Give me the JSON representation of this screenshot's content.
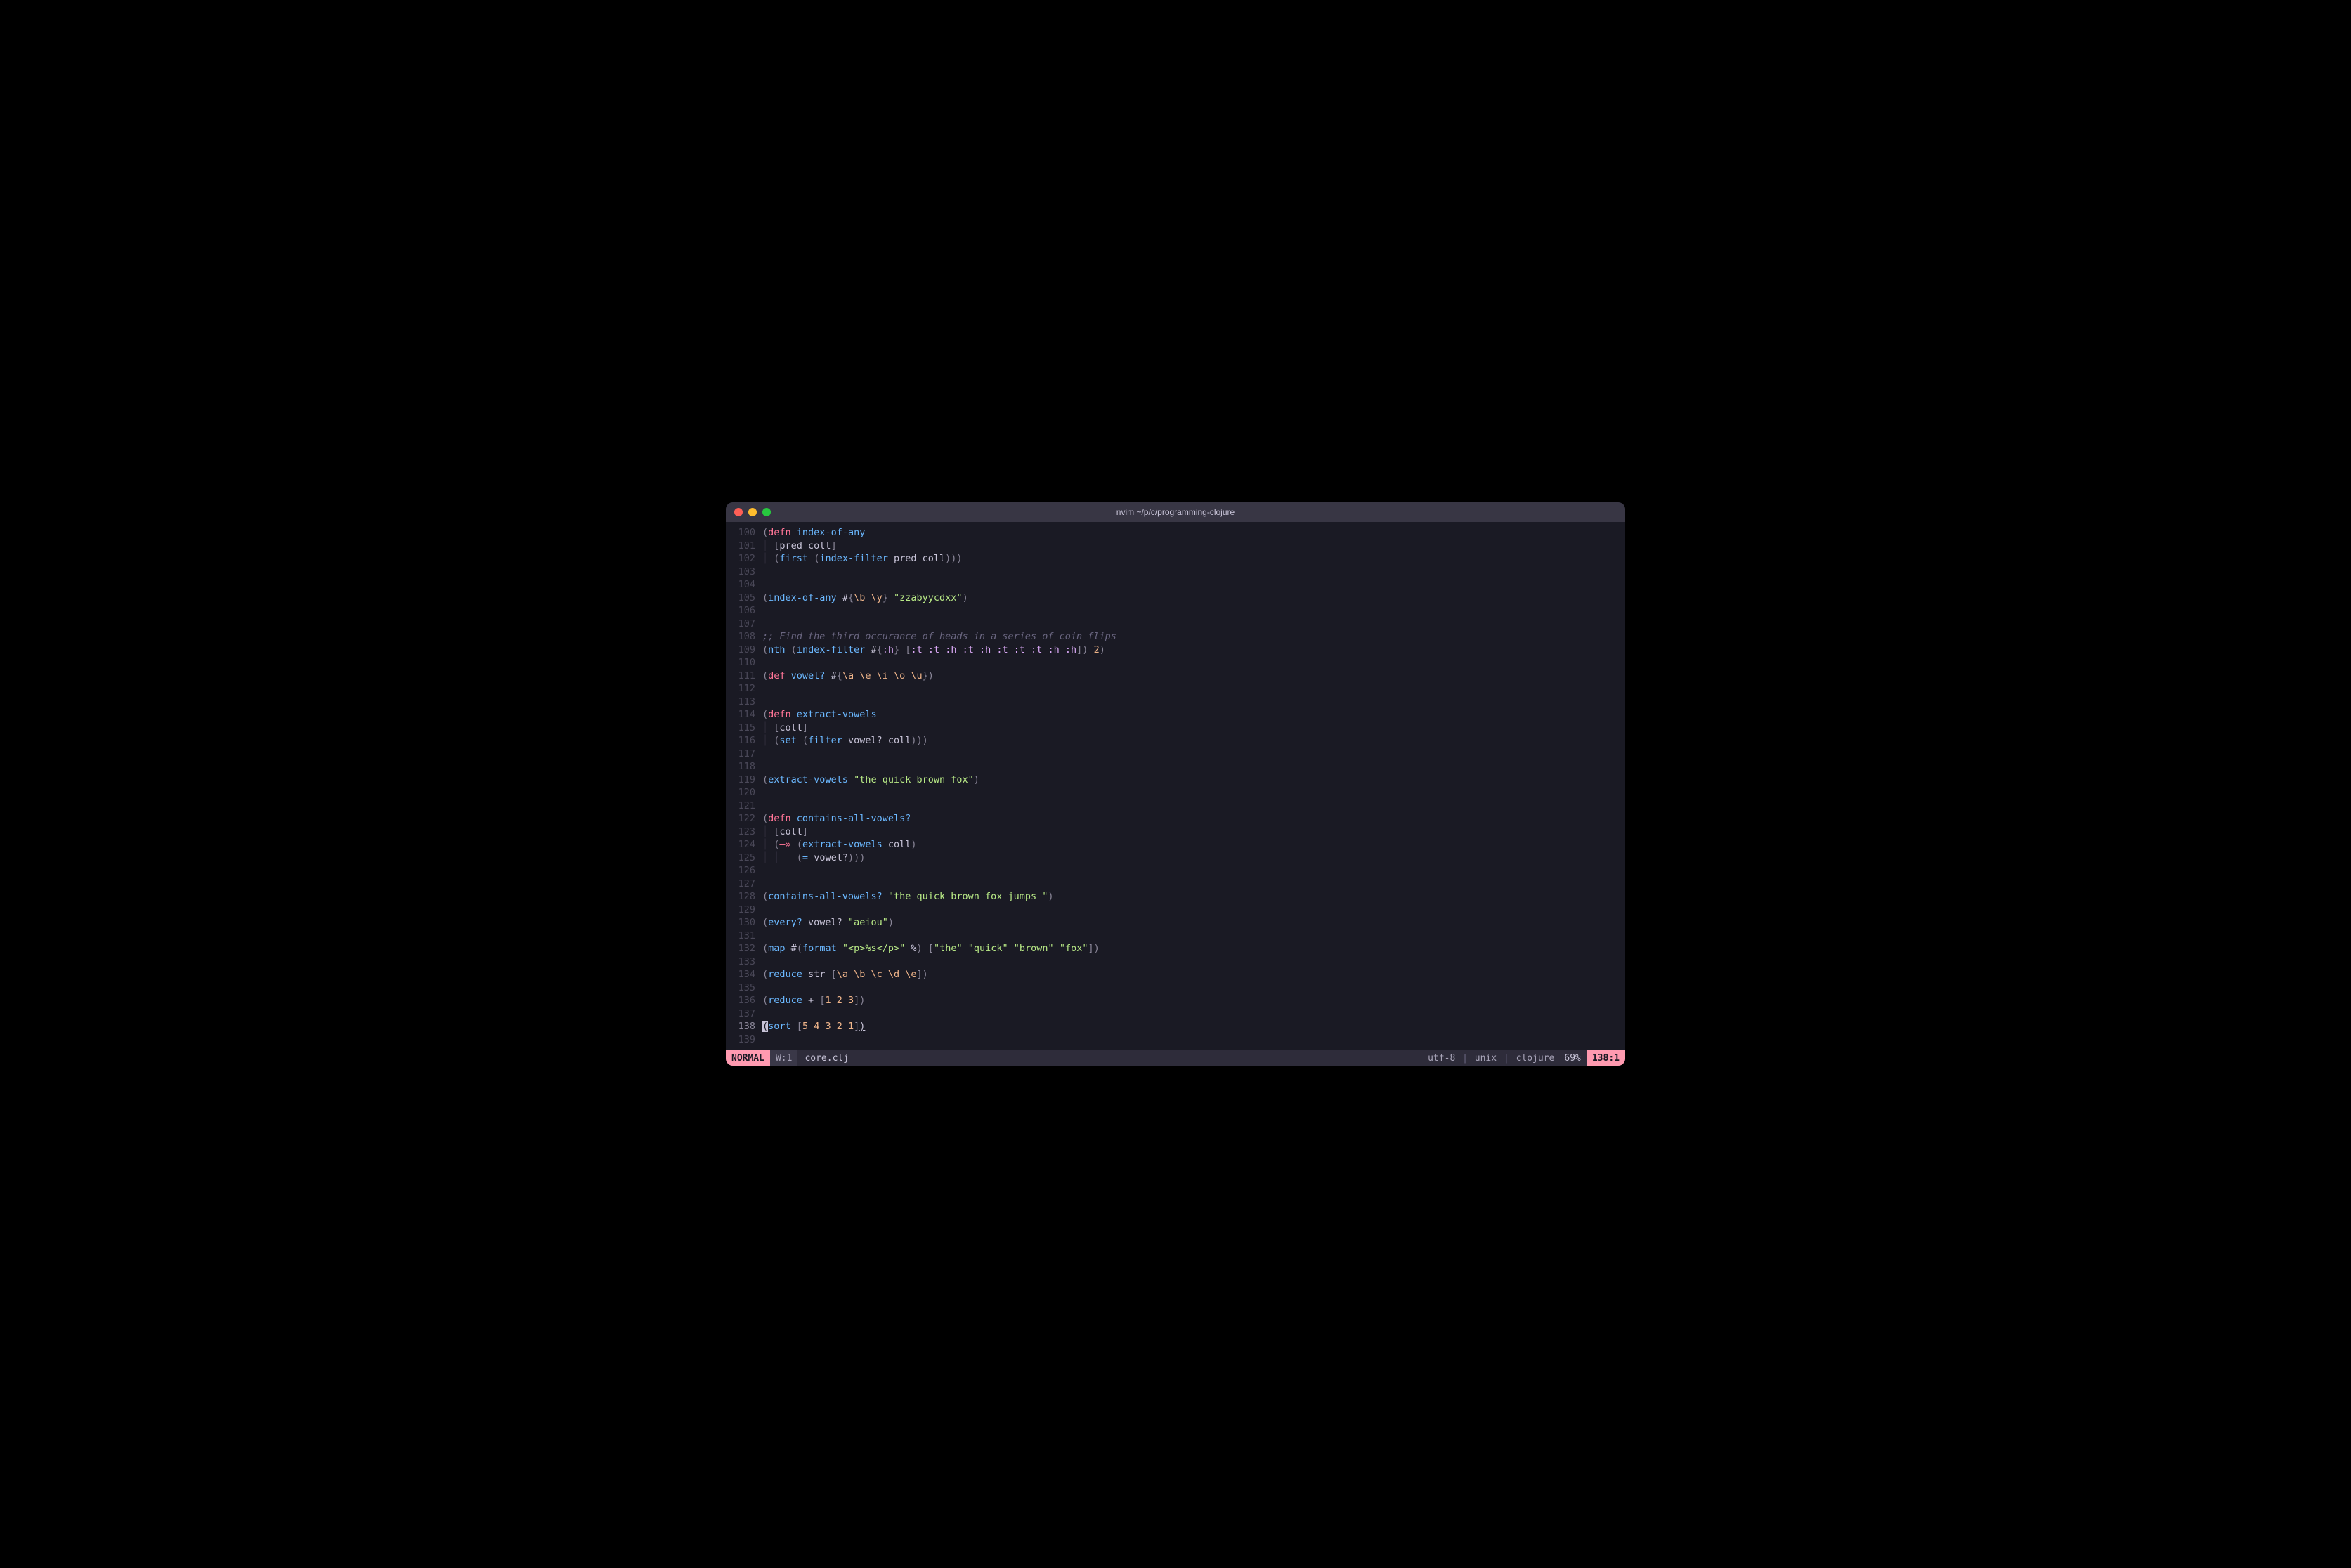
{
  "window": {
    "title": "nvim ~/p/c/programming-clojure"
  },
  "lines": [
    {
      "num": "100",
      "tokens": [
        {
          "t": "paren",
          "v": "("
        },
        {
          "t": "keyword",
          "v": "defn"
        },
        {
          "t": "plain",
          "v": " "
        },
        {
          "t": "fn-name",
          "v": "index-of-any"
        }
      ]
    },
    {
      "num": "101",
      "tokens": [
        {
          "t": "indent",
          "v": "│ "
        },
        {
          "t": "bracket",
          "v": "["
        },
        {
          "t": "symbol",
          "v": "pred coll"
        },
        {
          "t": "bracket",
          "v": "]"
        }
      ]
    },
    {
      "num": "102",
      "tokens": [
        {
          "t": "indent",
          "v": "│ "
        },
        {
          "t": "paren",
          "v": "("
        },
        {
          "t": "fn-name",
          "v": "first"
        },
        {
          "t": "plain",
          "v": " "
        },
        {
          "t": "paren",
          "v": "("
        },
        {
          "t": "fn-name",
          "v": "index-filter"
        },
        {
          "t": "plain",
          "v": " pred coll"
        },
        {
          "t": "paren",
          "v": ")))"
        }
      ]
    },
    {
      "num": "103",
      "tokens": []
    },
    {
      "num": "104",
      "tokens": []
    },
    {
      "num": "105",
      "tokens": [
        {
          "t": "paren",
          "v": "("
        },
        {
          "t": "fn-name",
          "v": "index-of-any"
        },
        {
          "t": "plain",
          "v": " #"
        },
        {
          "t": "bracket",
          "v": "{"
        },
        {
          "t": "char",
          "v": "\\b \\y"
        },
        {
          "t": "bracket",
          "v": "}"
        },
        {
          "t": "plain",
          "v": " "
        },
        {
          "t": "string",
          "v": "\"zzabyycdxx\""
        },
        {
          "t": "paren",
          "v": ")"
        }
      ]
    },
    {
      "num": "106",
      "tokens": []
    },
    {
      "num": "107",
      "tokens": []
    },
    {
      "num": "108",
      "tokens": [
        {
          "t": "comment",
          "v": ";; Find the third occurance of heads in a series of coin flips"
        }
      ]
    },
    {
      "num": "109",
      "tokens": [
        {
          "t": "paren",
          "v": "("
        },
        {
          "t": "fn-name",
          "v": "nth"
        },
        {
          "t": "plain",
          "v": " "
        },
        {
          "t": "paren",
          "v": "("
        },
        {
          "t": "fn-name",
          "v": "index-filter"
        },
        {
          "t": "plain",
          "v": " #"
        },
        {
          "t": "bracket",
          "v": "{"
        },
        {
          "t": "keyword2",
          "v": ":h"
        },
        {
          "t": "bracket",
          "v": "}"
        },
        {
          "t": "plain",
          "v": " "
        },
        {
          "t": "bracket",
          "v": "["
        },
        {
          "t": "keyword2",
          "v": ":t :t :h :t :h :t :t :t :h :h"
        },
        {
          "t": "bracket",
          "v": "]"
        },
        {
          "t": "paren",
          "v": ")"
        },
        {
          "t": "plain",
          "v": " "
        },
        {
          "t": "number",
          "v": "2"
        },
        {
          "t": "paren",
          "v": ")"
        }
      ]
    },
    {
      "num": "110",
      "tokens": []
    },
    {
      "num": "111",
      "tokens": [
        {
          "t": "paren",
          "v": "("
        },
        {
          "t": "keyword",
          "v": "def"
        },
        {
          "t": "plain",
          "v": " "
        },
        {
          "t": "fn-name",
          "v": "vowel?"
        },
        {
          "t": "plain",
          "v": " #"
        },
        {
          "t": "bracket",
          "v": "{"
        },
        {
          "t": "char",
          "v": "\\a \\e \\i \\o \\u"
        },
        {
          "t": "bracket",
          "v": "}"
        },
        {
          "t": "paren",
          "v": ")"
        }
      ]
    },
    {
      "num": "112",
      "tokens": []
    },
    {
      "num": "113",
      "tokens": []
    },
    {
      "num": "114",
      "tokens": [
        {
          "t": "paren",
          "v": "("
        },
        {
          "t": "keyword",
          "v": "defn"
        },
        {
          "t": "plain",
          "v": " "
        },
        {
          "t": "fn-name",
          "v": "extract-vowels"
        }
      ]
    },
    {
      "num": "115",
      "tokens": [
        {
          "t": "indent",
          "v": "│ "
        },
        {
          "t": "bracket",
          "v": "["
        },
        {
          "t": "symbol",
          "v": "coll"
        },
        {
          "t": "bracket",
          "v": "]"
        }
      ]
    },
    {
      "num": "116",
      "tokens": [
        {
          "t": "indent",
          "v": "│ "
        },
        {
          "t": "paren",
          "v": "("
        },
        {
          "t": "fn-name",
          "v": "set"
        },
        {
          "t": "plain",
          "v": " "
        },
        {
          "t": "paren",
          "v": "("
        },
        {
          "t": "fn-name",
          "v": "filter"
        },
        {
          "t": "plain",
          "v": " vowel? coll"
        },
        {
          "t": "paren",
          "v": ")))"
        }
      ]
    },
    {
      "num": "117",
      "tokens": []
    },
    {
      "num": "118",
      "tokens": []
    },
    {
      "num": "119",
      "tokens": [
        {
          "t": "paren",
          "v": "("
        },
        {
          "t": "fn-name",
          "v": "extract-vowels"
        },
        {
          "t": "plain",
          "v": " "
        },
        {
          "t": "string",
          "v": "\"the quick brown fox\""
        },
        {
          "t": "paren",
          "v": ")"
        }
      ]
    },
    {
      "num": "120",
      "tokens": []
    },
    {
      "num": "121",
      "tokens": []
    },
    {
      "num": "122",
      "tokens": [
        {
          "t": "paren",
          "v": "("
        },
        {
          "t": "keyword",
          "v": "defn"
        },
        {
          "t": "plain",
          "v": " "
        },
        {
          "t": "fn-name",
          "v": "contains-all-vowels?"
        }
      ]
    },
    {
      "num": "123",
      "tokens": [
        {
          "t": "indent",
          "v": "│ "
        },
        {
          "t": "bracket",
          "v": "["
        },
        {
          "t": "symbol",
          "v": "coll"
        },
        {
          "t": "bracket",
          "v": "]"
        }
      ]
    },
    {
      "num": "124",
      "tokens": [
        {
          "t": "indent",
          "v": "│ "
        },
        {
          "t": "paren",
          "v": "("
        },
        {
          "t": "arrow",
          "v": "—»"
        },
        {
          "t": "plain",
          "v": " "
        },
        {
          "t": "paren",
          "v": "("
        },
        {
          "t": "fn-name",
          "v": "extract-vowels"
        },
        {
          "t": "plain",
          "v": " coll"
        },
        {
          "t": "paren",
          "v": ")"
        }
      ]
    },
    {
      "num": "125",
      "tokens": [
        {
          "t": "indent",
          "v": "│ │   "
        },
        {
          "t": "paren",
          "v": "("
        },
        {
          "t": "fn-name",
          "v": "="
        },
        {
          "t": "plain",
          "v": " vowel?"
        },
        {
          "t": "paren",
          "v": ")))"
        }
      ]
    },
    {
      "num": "126",
      "tokens": []
    },
    {
      "num": "127",
      "tokens": []
    },
    {
      "num": "128",
      "tokens": [
        {
          "t": "paren",
          "v": "("
        },
        {
          "t": "fn-name",
          "v": "contains-all-vowels?"
        },
        {
          "t": "plain",
          "v": " "
        },
        {
          "t": "string",
          "v": "\"the quick brown fox jumps \""
        },
        {
          "t": "paren",
          "v": ")"
        }
      ]
    },
    {
      "num": "129",
      "tokens": []
    },
    {
      "num": "130",
      "tokens": [
        {
          "t": "paren",
          "v": "("
        },
        {
          "t": "fn-name",
          "v": "every?"
        },
        {
          "t": "plain",
          "v": " vowel? "
        },
        {
          "t": "string",
          "v": "\"aeiou\""
        },
        {
          "t": "paren",
          "v": ")"
        }
      ]
    },
    {
      "num": "131",
      "tokens": []
    },
    {
      "num": "132",
      "tokens": [
        {
          "t": "paren",
          "v": "("
        },
        {
          "t": "fn-name",
          "v": "map"
        },
        {
          "t": "plain",
          "v": " #"
        },
        {
          "t": "paren",
          "v": "("
        },
        {
          "t": "fn-name",
          "v": "format"
        },
        {
          "t": "plain",
          "v": " "
        },
        {
          "t": "string",
          "v": "\"<p>%s</p>\""
        },
        {
          "t": "plain",
          "v": " %"
        },
        {
          "t": "paren",
          "v": ")"
        },
        {
          "t": "plain",
          "v": " "
        },
        {
          "t": "bracket",
          "v": "["
        },
        {
          "t": "string",
          "v": "\"the\""
        },
        {
          "t": "plain",
          "v": " "
        },
        {
          "t": "string",
          "v": "\"quick\""
        },
        {
          "t": "plain",
          "v": " "
        },
        {
          "t": "string",
          "v": "\"brown\""
        },
        {
          "t": "plain",
          "v": " "
        },
        {
          "t": "string",
          "v": "\"fox\""
        },
        {
          "t": "bracket",
          "v": "]"
        },
        {
          "t": "paren",
          "v": ")"
        }
      ]
    },
    {
      "num": "133",
      "tokens": []
    },
    {
      "num": "134",
      "tokens": [
        {
          "t": "paren",
          "v": "("
        },
        {
          "t": "fn-name",
          "v": "reduce"
        },
        {
          "t": "plain",
          "v": " str "
        },
        {
          "t": "bracket",
          "v": "["
        },
        {
          "t": "char",
          "v": "\\a \\b \\c \\d \\e"
        },
        {
          "t": "bracket",
          "v": "]"
        },
        {
          "t": "paren",
          "v": ")"
        }
      ]
    },
    {
      "num": "135",
      "tokens": []
    },
    {
      "num": "136",
      "tokens": [
        {
          "t": "paren",
          "v": "("
        },
        {
          "t": "fn-name",
          "v": "reduce"
        },
        {
          "t": "plain",
          "v": " + "
        },
        {
          "t": "bracket",
          "v": "["
        },
        {
          "t": "number",
          "v": "1 2 3"
        },
        {
          "t": "bracket",
          "v": "]"
        },
        {
          "t": "paren",
          "v": ")"
        }
      ]
    },
    {
      "num": "137",
      "tokens": []
    },
    {
      "num": "138",
      "active": true,
      "tokens": [
        {
          "t": "cursor",
          "v": "("
        },
        {
          "t": "fn-name",
          "v": "sort"
        },
        {
          "t": "plain",
          "v": " "
        },
        {
          "t": "bracket",
          "v": "["
        },
        {
          "t": "number",
          "v": "5 4 3 2 1"
        },
        {
          "t": "bracket",
          "v": "]"
        },
        {
          "t": "match",
          "v": ")"
        }
      ]
    },
    {
      "num": "139",
      "tokens": []
    }
  ],
  "status": {
    "mode": "NORMAL",
    "warning": "W:1",
    "filename": "core.clj",
    "encoding": "utf-8",
    "fileformat": "unix",
    "filetype": "clojure",
    "percent": "69%",
    "position": "138:1"
  }
}
